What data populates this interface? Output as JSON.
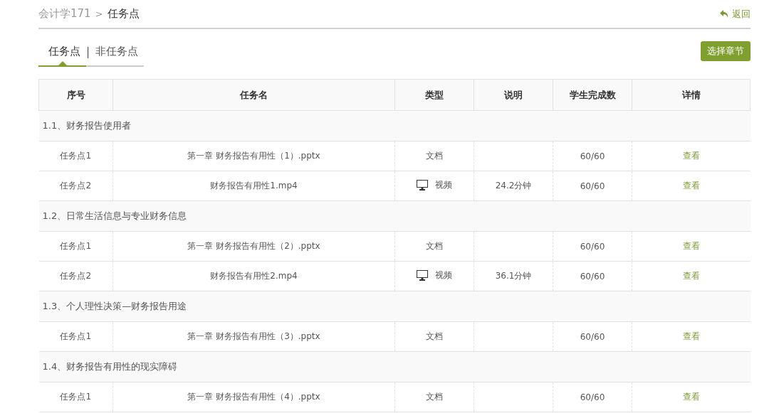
{
  "breadcrumb": {
    "parent": "会计学171",
    "separator": ">",
    "current": "任务点"
  },
  "back_link": "返回",
  "tabs": [
    {
      "label": "任务点",
      "selected": true
    },
    {
      "label": "非任务点",
      "selected": false
    }
  ],
  "tab_separator": "|",
  "choose_chapter_button": "选择章节",
  "table": {
    "columns": [
      "序号",
      "任务名",
      "类型",
      "说明",
      "学生完成数",
      "详情"
    ],
    "sections": [
      {
        "title": "1.1、财务报告使用者",
        "rows": [
          {
            "index": "任务点1",
            "name": "第一章 财务报告有用性（1）.pptx",
            "kind": "document",
            "type": "文档",
            "note": "",
            "completed": "60/60",
            "action": "查看"
          },
          {
            "index": "任务点2",
            "name": "财务报告有用性1.mp4",
            "kind": "video",
            "type": "视频",
            "note": "24.2分钟",
            "completed": "60/60",
            "action": "查看"
          }
        ]
      },
      {
        "title": "1.2、日常生活信息与专业财务信息",
        "rows": [
          {
            "index": "任务点1",
            "name": "第一章 财务报告有用性（2）.pptx",
            "kind": "document",
            "type": "文档",
            "note": "",
            "completed": "60/60",
            "action": "查看"
          },
          {
            "index": "任务点2",
            "name": "财务报告有用性2.mp4",
            "kind": "video",
            "type": "视频",
            "note": "36.1分钟",
            "completed": "60/60",
            "action": "查看"
          }
        ]
      },
      {
        "title": "1.3、个人理性决策—财务报告用途",
        "rows": [
          {
            "index": "任务点1",
            "name": "第一章 财务报告有用性（3）.pptx",
            "kind": "document",
            "type": "文档",
            "note": "",
            "completed": "60/60",
            "action": "查看"
          }
        ]
      },
      {
        "title": "1.4、财务报告有用性的现实障碍",
        "rows": [
          {
            "index": "任务点1",
            "name": "第一章 财务报告有用性（4）.pptx",
            "kind": "document",
            "type": "文档",
            "note": "",
            "completed": "60/60",
            "action": "查看"
          }
        ]
      }
    ]
  }
}
